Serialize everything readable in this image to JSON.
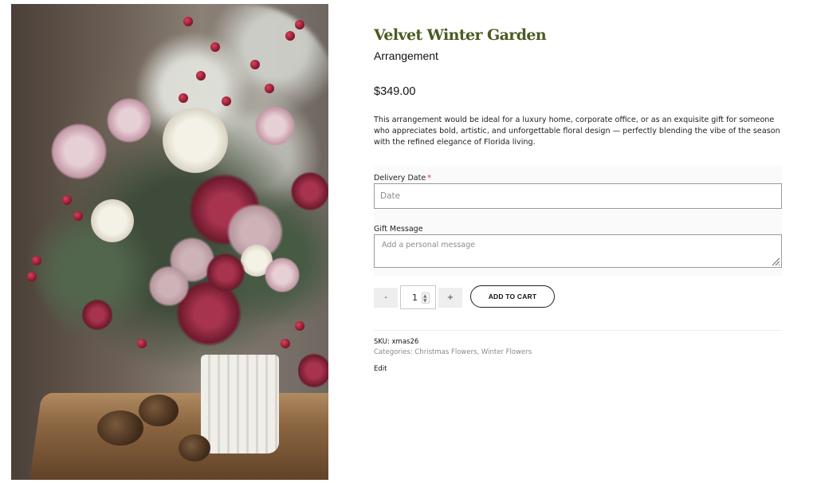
{
  "product": {
    "title": "Velvet Winter Garden",
    "subtitle": "Arrangement",
    "price": "$349.00",
    "description": "This arrangement would be ideal for a luxury home, corporate office, or as an exquisite gift for someone who appreciates bold, artistic, and unforgettable floral design — perfectly blending the vibe of the season with the refined elegance of Florida living."
  },
  "form": {
    "delivery_date_label": "Delivery Date",
    "required_mark": "*",
    "delivery_date_placeholder": "Date",
    "gift_message_label": "Gift Message",
    "gift_message_placeholder": "Add a personal message"
  },
  "cart": {
    "minus_label": "-",
    "quantity": "1",
    "plus_label": "+",
    "add_to_cart_label": "ADD TO CART"
  },
  "meta": {
    "sku_label": "SKU:",
    "sku_value": "xmas26",
    "categories_label": "Categories:",
    "categories": [
      "Christmas Flowers",
      "Winter Flowers"
    ],
    "category_separator": ",",
    "edit_label": "Edit"
  },
  "colors": {
    "title_green": "#4a5a22",
    "required_red": "#d0253b",
    "muted_gray": "#8a8a8a"
  },
  "icons": {
    "resize": "resize-grip-icon",
    "spinner": "spinner-arrows-icon"
  }
}
